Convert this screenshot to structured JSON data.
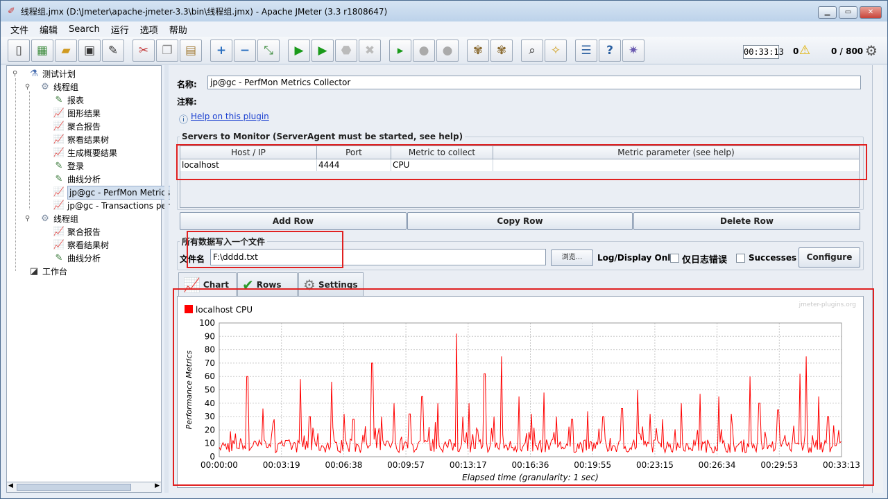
{
  "window": {
    "title": "线程组.jmx (D:\\Jmeter\\apache-jmeter-3.3\\bin\\线程组.jmx) - Apache JMeter (3.3 r1808647)",
    "min_label": "▁",
    "max_label": "▭",
    "close_label": "✕"
  },
  "menubar": {
    "items": [
      "文件",
      "编辑",
      "Search",
      "运行",
      "选项",
      "帮助"
    ]
  },
  "status": {
    "elapsed": "00:33:13",
    "errors": "0",
    "threads": "0 / 800"
  },
  "tree": {
    "items": [
      {
        "label": "测试计划",
        "icon": "flask-icon",
        "glyph": "⚗",
        "color": "#4a6fb0",
        "x": 30,
        "y": 3,
        "name": "tree-test-plan"
      },
      {
        "label": "线程组",
        "icon": "gear-icon",
        "glyph": "⚙",
        "color": "#7a8aa0",
        "x": 46,
        "y": 22,
        "name": "tree-thread-group-1"
      },
      {
        "label": "报表",
        "icon": "pipette-icon",
        "glyph": "✎",
        "color": "#3a7a3a",
        "x": 66,
        "y": 41,
        "name": "tree-report"
      },
      {
        "label": "图形结果",
        "icon": "graph-icon",
        "glyph": "📈",
        "color": "#c04080",
        "x": 66,
        "y": 60,
        "name": "tree-graph-results"
      },
      {
        "label": "聚合报告",
        "icon": "graph-icon",
        "glyph": "📈",
        "color": "#c04080",
        "x": 66,
        "y": 79,
        "name": "tree-aggregate-report"
      },
      {
        "label": "察看结果树",
        "icon": "graph-icon",
        "glyph": "📈",
        "color": "#c04080",
        "x": 66,
        "y": 98,
        "name": "tree-view-results-tree"
      },
      {
        "label": "生成概要结果",
        "icon": "graph-icon",
        "glyph": "📈",
        "color": "#c04080",
        "x": 66,
        "y": 117,
        "name": "tree-summary-results"
      },
      {
        "label": "登录",
        "icon": "pipette-icon",
        "glyph": "✎",
        "color": "#3a7a3a",
        "x": 66,
        "y": 136,
        "name": "tree-login"
      },
      {
        "label": "曲线分析",
        "icon": "pipette-icon",
        "glyph": "✎",
        "color": "#3a7a3a",
        "x": 66,
        "y": 155,
        "name": "tree-curve-analysis"
      },
      {
        "label": "jp@gc - PerfMon Metrics C",
        "icon": "graph-icon",
        "glyph": "📈",
        "color": "#c04080",
        "x": 66,
        "y": 174,
        "name": "tree-perfmon",
        "selected": true
      },
      {
        "label": "jp@gc - Transactions per",
        "icon": "graph-icon",
        "glyph": "📈",
        "color": "#c04080",
        "x": 66,
        "y": 193,
        "name": "tree-transactions"
      },
      {
        "label": "线程组",
        "icon": "gear-icon",
        "glyph": "⚙",
        "color": "#7a8aa0",
        "x": 46,
        "y": 212,
        "name": "tree-thread-group-2"
      },
      {
        "label": "聚合报告",
        "icon": "graph-icon",
        "glyph": "📈",
        "color": "#c04080",
        "x": 66,
        "y": 231,
        "name": "tree-aggregate-report-2"
      },
      {
        "label": "察看结果树",
        "icon": "graph-icon",
        "glyph": "📈",
        "color": "#c04080",
        "x": 66,
        "y": 250,
        "name": "tree-view-results-tree-2"
      },
      {
        "label": "曲线分析",
        "icon": "pipette-icon",
        "glyph": "✎",
        "color": "#3a7a3a",
        "x": 66,
        "y": 269,
        "name": "tree-curve-analysis-2"
      },
      {
        "label": "工作台",
        "icon": "workbench-icon",
        "glyph": "◪",
        "color": "#333",
        "x": 30,
        "y": 288,
        "name": "tree-workbench"
      }
    ]
  },
  "form": {
    "name_label": "名称:",
    "name_value": "jp@gc - PerfMon Metrics Collector",
    "comment_label": "注释:",
    "comment_value": "",
    "help_link": "Help on this plugin"
  },
  "servers": {
    "title": "Servers to Monitor (ServerAgent must be started, see help)",
    "columns": [
      "Host / IP",
      "Port",
      "Metric to collect",
      "Metric parameter (see help)"
    ],
    "rows": [
      [
        "localhost",
        "4444",
        "CPU",
        ""
      ]
    ],
    "add_row": "Add Row",
    "copy_row": "Copy Row",
    "delete_row": "Delete Row"
  },
  "file": {
    "title": "所有数据写入一个文件",
    "label": "文件名",
    "value": "F:\\dddd.txt",
    "browse": "浏览...",
    "log_display_label": "Log/Display Only:",
    "errors_only": "仅日志错误",
    "successes": "Successes",
    "configure": "Configure"
  },
  "tabs": [
    {
      "label": "Chart",
      "icon": "chart-icon",
      "name": "tab-chart",
      "active": true
    },
    {
      "label": "Rows",
      "icon": "check-icon",
      "name": "tab-rows",
      "active": false
    },
    {
      "label": "Settings",
      "icon": "gear-icon",
      "name": "tab-settings",
      "active": false
    }
  ],
  "chart_data": {
    "type": "line",
    "watermark": "jmeter-plugins.org",
    "legend": {
      "placement": "top-left",
      "entries": [
        {
          "name": "localhost CPU",
          "color": "#ff0000"
        }
      ]
    },
    "ylabel": "Performance Metrics",
    "xlabel": "Elapsed time (granularity: 1 sec)",
    "ylim": [
      0,
      100
    ],
    "yticks": [
      0,
      10,
      20,
      30,
      40,
      50,
      60,
      70,
      80,
      90,
      100
    ],
    "xticks": [
      "00:00:00",
      "00:03:19",
      "00:06:38",
      "00:09:57",
      "00:13:17",
      "00:16:36",
      "00:19:55",
      "00:23:15",
      "00:26:34",
      "00:29:53",
      "00:33:13"
    ],
    "xlim_seconds": [
      0,
      1993
    ],
    "grid": true,
    "series": [
      {
        "name": "localhost CPU",
        "color": "#ff0000",
        "baseline": 8,
        "peaks": [
          [
            90,
            60
          ],
          [
            140,
            36
          ],
          [
            175,
            28
          ],
          [
            260,
            58
          ],
          [
            290,
            30
          ],
          [
            360,
            56
          ],
          [
            400,
            32
          ],
          [
            430,
            28
          ],
          [
            490,
            70
          ],
          [
            520,
            30
          ],
          [
            560,
            40
          ],
          [
            610,
            32
          ],
          [
            650,
            45
          ],
          [
            700,
            40
          ],
          [
            760,
            92
          ],
          [
            780,
            30
          ],
          [
            800,
            40
          ],
          [
            850,
            62
          ],
          [
            880,
            30
          ],
          [
            905,
            75
          ],
          [
            960,
            45
          ],
          [
            1000,
            32
          ],
          [
            1040,
            48
          ],
          [
            1080,
            30
          ],
          [
            1130,
            28
          ],
          [
            1180,
            34
          ],
          [
            1230,
            30
          ],
          [
            1290,
            36
          ],
          [
            1340,
            50
          ],
          [
            1380,
            32
          ],
          [
            1420,
            28
          ],
          [
            1480,
            40
          ],
          [
            1540,
            47
          ],
          [
            1600,
            45
          ],
          [
            1640,
            32
          ],
          [
            1700,
            60
          ],
          [
            1730,
            40
          ],
          [
            1790,
            35
          ],
          [
            1860,
            62
          ],
          [
            1880,
            75
          ],
          [
            1920,
            45
          ],
          [
            1950,
            30
          ]
        ]
      }
    ]
  },
  "annotations": {
    "color": "#e02020"
  }
}
